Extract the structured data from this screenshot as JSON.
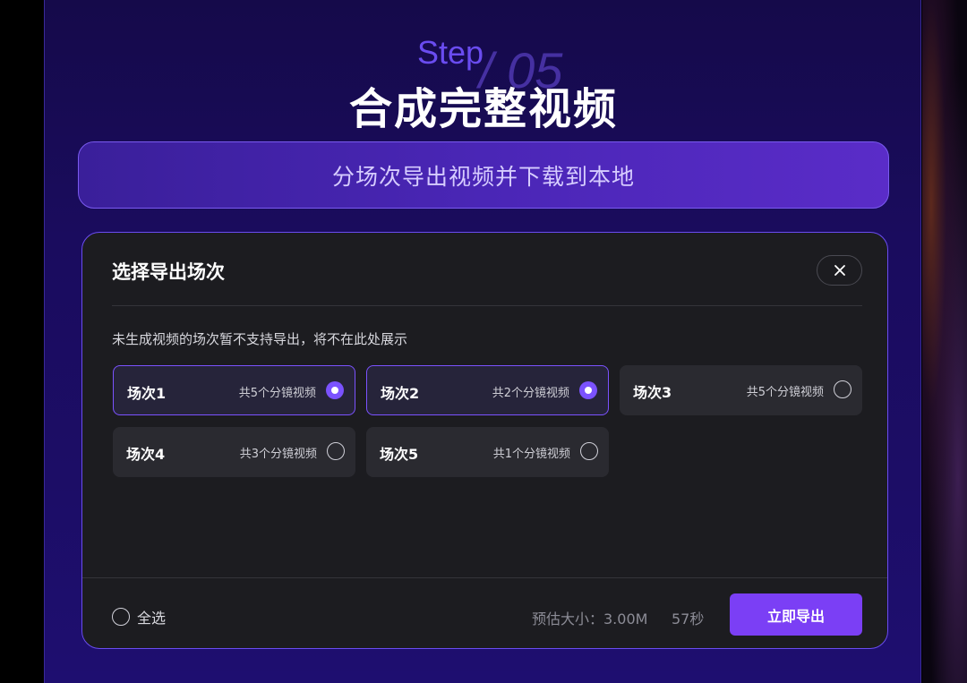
{
  "hero": {
    "step_label": "Step",
    "step_number": "/ 05",
    "title": "合成完整视频",
    "subtitle": "分场次导出视频并下载到本地"
  },
  "dialog": {
    "title": "选择导出场次",
    "close_icon": "close-icon",
    "notice": "未生成视频的场次暂不支持导出，将不在此处展示",
    "scenes": [
      {
        "name": "场次1",
        "count": "共5个分镜视频",
        "selected": true
      },
      {
        "name": "场次2",
        "count": "共2个分镜视频",
        "selected": true
      },
      {
        "name": "场次3",
        "count": "共5个分镜视频",
        "selected": false
      },
      {
        "name": "场次4",
        "count": "共3个分镜视频",
        "selected": false
      },
      {
        "name": "场次5",
        "count": "共1个分镜视频",
        "selected": false
      }
    ],
    "footer": {
      "select_all_label": "全选",
      "estimate": "预估大小：3.00M",
      "duration": "57秒",
      "export_label": "立即导出"
    }
  },
  "colors": {
    "accent": "#7b52ff",
    "export_button": "#7b3ff5",
    "dialog_bg": "#1c1c20",
    "panel_bg": "#1a0c5e"
  }
}
